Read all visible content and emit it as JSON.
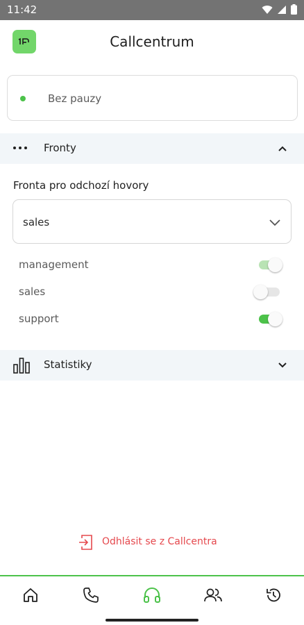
{
  "status_bar": {
    "time": "11:42",
    "icons": [
      "wifi-icon",
      "signal-icon",
      "battery-icon"
    ]
  },
  "header": {
    "title": "Callcentrum",
    "logo_text": "1P",
    "logo_color": "#72d66a"
  },
  "pause": {
    "label": "Bez pauzy",
    "status_color": "#4cc24a"
  },
  "queues_section": {
    "title": "Fronty",
    "expanded": true,
    "outgoing_label": "Fronta pro odchozí hovory",
    "outgoing_value": "sales",
    "items": [
      {
        "label": "management",
        "on": true,
        "disabled": true
      },
      {
        "label": "sales",
        "on": false,
        "disabled": true
      },
      {
        "label": "support",
        "on": true,
        "disabled": false
      }
    ]
  },
  "stats_section": {
    "title": "Statistiky",
    "expanded": false
  },
  "logout": {
    "label": "Odhlásit se z Callcentra",
    "color": "#e5484d"
  },
  "bottom_nav": {
    "items": [
      {
        "icon": "home-icon",
        "active": false
      },
      {
        "icon": "phone-icon",
        "active": false
      },
      {
        "icon": "headset-icon",
        "active": true
      },
      {
        "icon": "contacts-icon",
        "active": false
      },
      {
        "icon": "history-icon",
        "active": false
      }
    ],
    "accent": "#4cc24a"
  }
}
